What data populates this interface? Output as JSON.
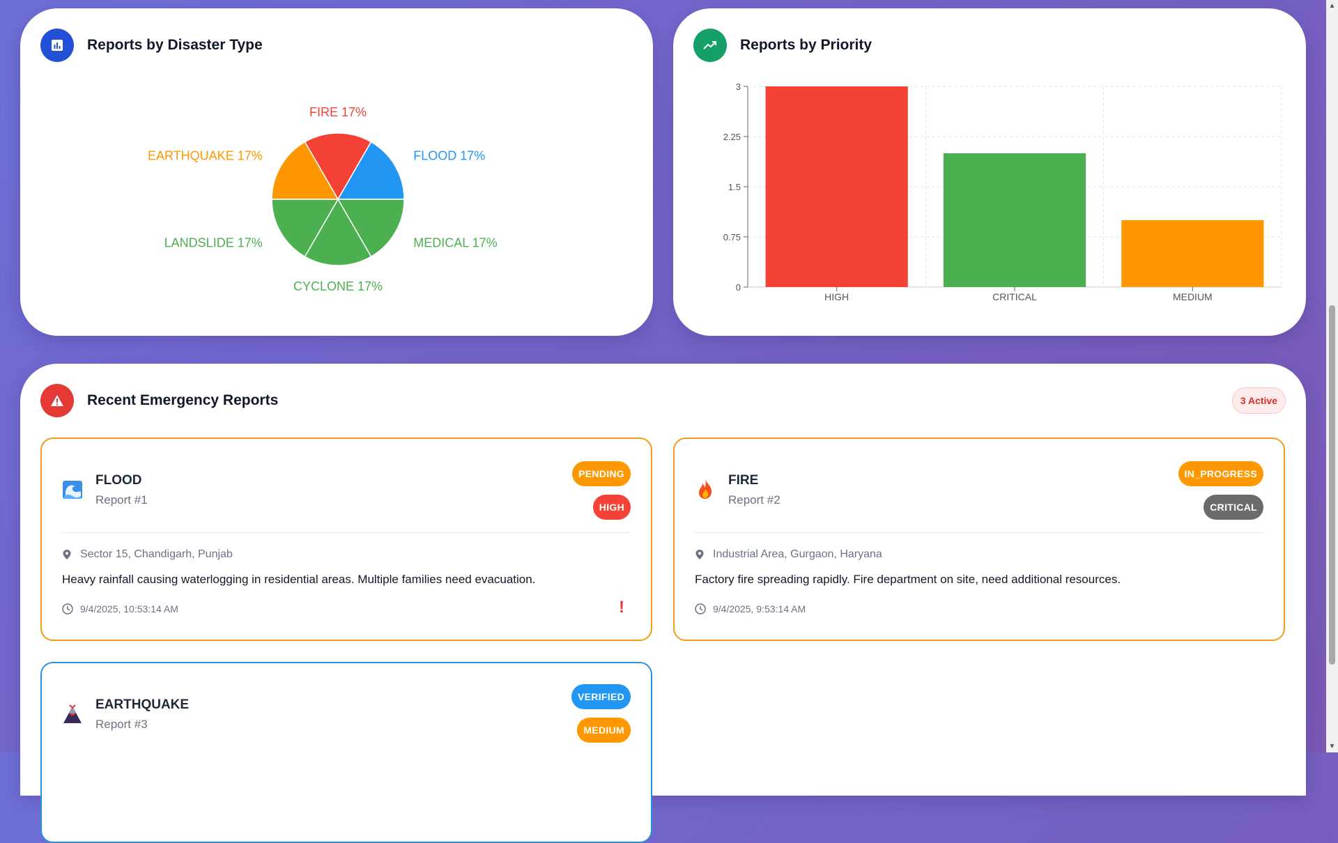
{
  "colors": {
    "fire": "#f44336",
    "flood": "#2196f3",
    "earthquake": "#ff9800",
    "landslide": "#4caf50",
    "medical": "#4caf50",
    "cyclone": "#4caf50",
    "high": "#f44336",
    "critical": "#4caf50",
    "medium": "#ff9800"
  },
  "type_card": {
    "title": "Reports by Disaster Type",
    "icon": "bar-chart-icon"
  },
  "priority_card": {
    "title": "Reports by Priority",
    "icon": "trending-up-icon"
  },
  "chart_data": [
    {
      "type": "pie",
      "slices": [
        {
          "label": "FIRE",
          "value": 17,
          "pct_label": "FIRE 17%",
          "color": "#f44336"
        },
        {
          "label": "FLOOD",
          "value": 17,
          "pct_label": "FLOOD 17%",
          "color": "#2196f3"
        },
        {
          "label": "MEDICAL",
          "value": 17,
          "pct_label": "MEDICAL 17%",
          "color": "#4caf50"
        },
        {
          "label": "CYCLONE",
          "value": 17,
          "pct_label": "CYCLONE 17%",
          "color": "#4caf50"
        },
        {
          "label": "LANDSLIDE",
          "value": 17,
          "pct_label": "LANDSLIDE 17%",
          "color": "#4caf50"
        },
        {
          "label": "EARTHQUAKE",
          "value": 17,
          "pct_label": "EARTHQUAKE 17%",
          "color": "#ff9800"
        }
      ]
    },
    {
      "type": "bar",
      "categories": [
        "HIGH",
        "CRITICAL",
        "MEDIUM"
      ],
      "values": [
        3,
        2,
        1
      ],
      "colors": [
        "#f44336",
        "#4caf50",
        "#ff9800"
      ],
      "ylim": [
        0,
        3
      ],
      "yticks": [
        "0",
        "0.75",
        "1.5",
        "2.25",
        "3"
      ],
      "ytick_values": [
        0,
        0.75,
        1.5,
        2.25,
        3
      ],
      "grid": true
    }
  ],
  "recent": {
    "title": "Recent Emergency Reports",
    "icon": "warning-icon",
    "active_label": "3 Active",
    "reports": [
      {
        "type": "FLOOD",
        "number": "Report #1",
        "icon": "wave-icon",
        "status": "PENDING",
        "status_color": "#ff9800",
        "priority": "HIGH",
        "priority_color": "#f44336",
        "location": "Sector 15, Chandigarh, Punjab",
        "description": "Heavy rainfall causing waterlogging in residential areas. Multiple families need evacuation.",
        "time": "9/4/2025, 10:53:14 AM",
        "alert": "!"
      },
      {
        "type": "FIRE",
        "number": "Report #2",
        "icon": "fire-icon",
        "status": "IN_PROGRESS",
        "status_color": "#ff9800",
        "priority": "CRITICAL",
        "priority_color": "#6b6b6b",
        "location": "Industrial Area, Gurgaon, Haryana",
        "description": "Factory fire spreading rapidly. Fire department on site, need additional resources.",
        "time": "9/4/2025, 9:53:14 AM"
      },
      {
        "type": "EARTHQUAKE",
        "number": "Report #3",
        "icon": "volcano-icon",
        "status": "VERIFIED",
        "status_color": "#2196f3",
        "priority": "MEDIUM",
        "priority_color": "#ff9800"
      }
    ]
  }
}
